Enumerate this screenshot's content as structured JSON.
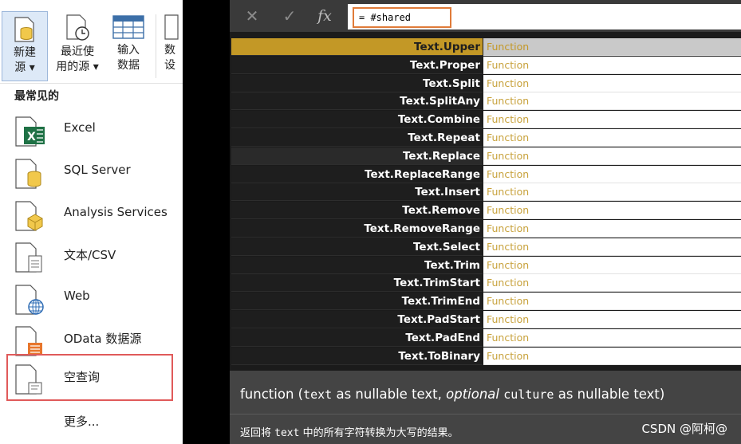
{
  "ribbon": {
    "new_source": [
      "新建",
      "源 ▾"
    ],
    "recent_sources": [
      "最近使",
      "用的源 ▾"
    ],
    "enter_data": [
      "输入",
      "数据"
    ],
    "cut_off": [
      "数",
      "设"
    ]
  },
  "sources": {
    "section_label": "最常见的",
    "items": [
      {
        "label": "Excel",
        "icon": "excel-icon"
      },
      {
        "label": "SQL Server",
        "icon": "sql-server-icon"
      },
      {
        "label": "Analysis Services",
        "icon": "analysis-services-icon"
      },
      {
        "label": "文本/CSV",
        "icon": "text-csv-icon"
      },
      {
        "label": "Web",
        "icon": "web-icon"
      },
      {
        "label": "OData 数据源",
        "icon": "odata-icon"
      },
      {
        "label": "空查询",
        "icon": "blank-query-icon"
      }
    ],
    "more": "更多..."
  },
  "formula": {
    "cancel": "✕",
    "ok": "✓",
    "fx": "fx",
    "value": "= #shared"
  },
  "functions": [
    {
      "name": "Text.Upper",
      "type": "Function"
    },
    {
      "name": "Text.Proper",
      "type": "Function"
    },
    {
      "name": "Text.Split",
      "type": "Function"
    },
    {
      "name": "Text.SplitAny",
      "type": "Function"
    },
    {
      "name": "Text.Combine",
      "type": "Function"
    },
    {
      "name": "Text.Repeat",
      "type": "Function"
    },
    {
      "name": "Text.Replace",
      "type": "Function"
    },
    {
      "name": "Text.ReplaceRange",
      "type": "Function"
    },
    {
      "name": "Text.Insert",
      "type": "Function"
    },
    {
      "name": "Text.Remove",
      "type": "Function"
    },
    {
      "name": "Text.RemoveRange",
      "type": "Function"
    },
    {
      "name": "Text.Select",
      "type": "Function"
    },
    {
      "name": "Text.Trim",
      "type": "Function"
    },
    {
      "name": "Text.TrimStart",
      "type": "Function"
    },
    {
      "name": "Text.TrimEnd",
      "type": "Function"
    },
    {
      "name": "Text.PadStart",
      "type": "Function"
    },
    {
      "name": "Text.PadEnd",
      "type": "Function"
    },
    {
      "name": "Text.ToBinary",
      "type": "Function"
    }
  ],
  "signature": {
    "keyword": "function (",
    "param1": "text",
    "as1": " as nullable text, ",
    "optional": "optional",
    "space": " ",
    "param2": "culture",
    "as2": " as nullable text)"
  },
  "description": {
    "before": "返回将 ",
    "param": "text",
    "after": " 中的所有字符转换为大写的结果。"
  },
  "watermark": "CSDN @阿柯@",
  "colors": {
    "selected_row": "#c39826",
    "type_text": "#c8a23c",
    "highlight_box": "#e05a5a",
    "formula_border": "#e07b39"
  }
}
